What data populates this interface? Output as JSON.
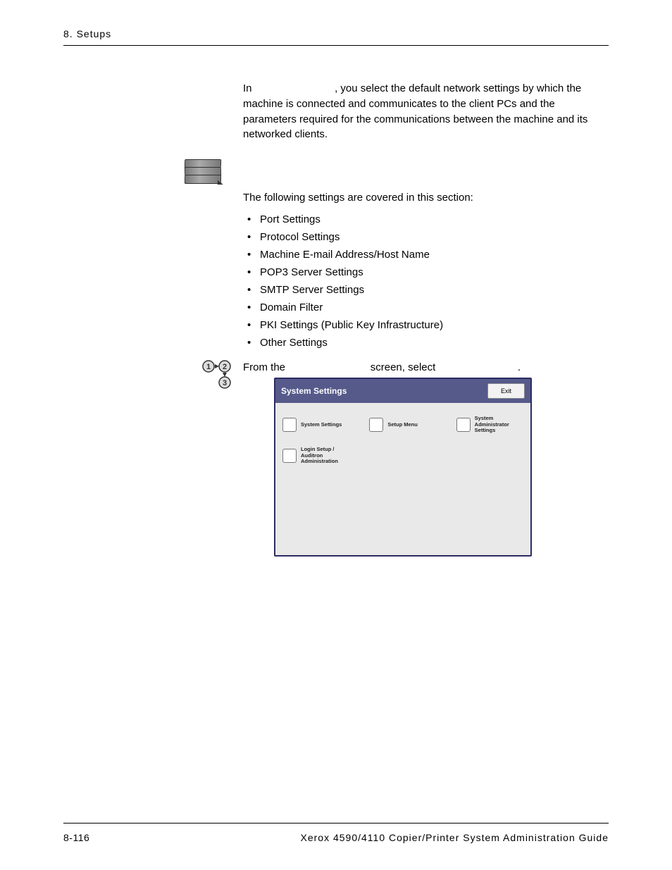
{
  "header": {
    "chapter": "8. Setups"
  },
  "intro": {
    "prefix": "In ",
    "suffix": ", you select the default network settings by which the machine is connected and communicates to the client PCs and the parameters required for the communications between the machine and its networked clients."
  },
  "section_intro": "The following settings are covered in this section:",
  "bullets": [
    "Port Settings",
    "Protocol Settings",
    "Machine E-mail Address/Host Name",
    "POP3 Server Settings",
    "SMTP Server Settings",
    "Domain Filter",
    "PKI Settings (Public Key Infrastructure)",
    "Other Settings"
  ],
  "step": {
    "prefix": "From the ",
    "middle": " screen, select ",
    "suffix": "."
  },
  "screenshot": {
    "title": "System Settings",
    "exit_label": "Exit",
    "tiles": [
      [
        {
          "label": "System Settings"
        },
        {
          "label": "Setup Menu"
        },
        {
          "label": "System Administrator Settings"
        }
      ],
      [
        {
          "label": "Login Setup / Auditron Administration"
        }
      ]
    ]
  },
  "footer": {
    "page": "8-116",
    "book": "Xerox 4590/4110 Copier/Printer System Administration Guide"
  }
}
